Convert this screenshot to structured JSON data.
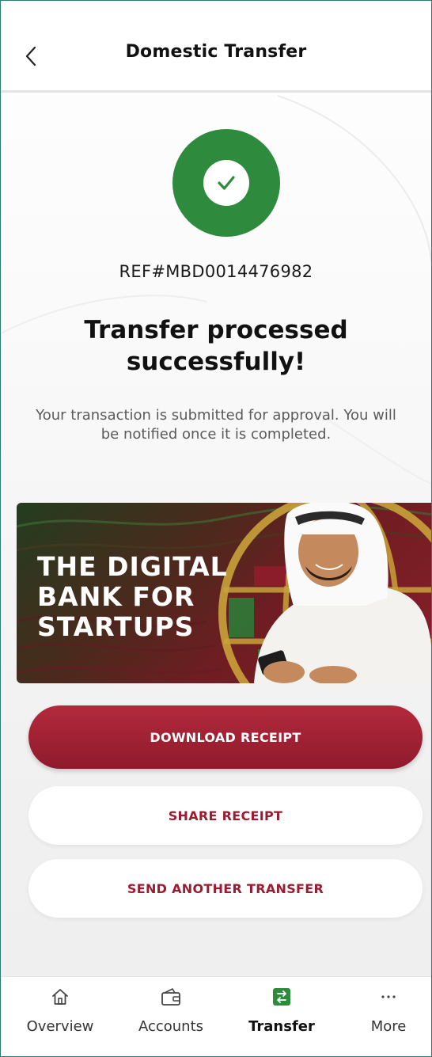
{
  "header": {
    "title": "Domestic Transfer",
    "back_icon": "chevron-left-icon"
  },
  "status": {
    "icon": "check-circle-icon",
    "icon_color": "#2e8b3e",
    "reference": "REF#MBD0014476982",
    "title": "Transfer processed successfully!",
    "message": "Your transaction is submitted for approval. You will be notified once it is completed."
  },
  "banner": {
    "headline_lines": [
      "THE DIGITAL",
      "BANK FOR",
      "STARTUPS"
    ]
  },
  "actions": {
    "download_label": "DOWNLOAD RECEIPT",
    "share_label": "SHARE RECEIPT",
    "another_label": "SEND ANOTHER TRANSFER",
    "primary_color": "#9b1b30"
  },
  "bottom_nav": {
    "items": [
      {
        "label": "Overview",
        "icon": "home-icon",
        "active": false
      },
      {
        "label": "Accounts",
        "icon": "wallet-icon",
        "active": false
      },
      {
        "label": "Transfer",
        "icon": "transfer-icon",
        "active": true
      },
      {
        "label": "More",
        "icon": "more-dots-icon",
        "active": false
      }
    ],
    "active_color": "#2e8b3e"
  }
}
